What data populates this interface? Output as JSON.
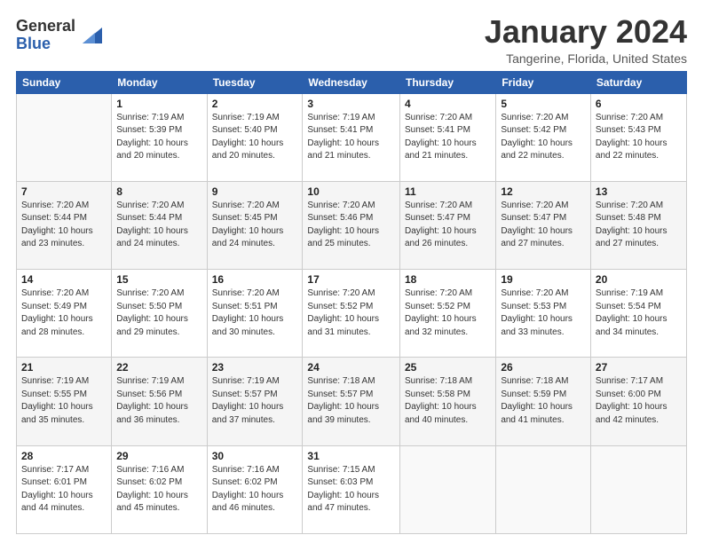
{
  "logo": {
    "general": "General",
    "blue": "Blue"
  },
  "title": "January 2024",
  "location": "Tangerine, Florida, United States",
  "headers": [
    "Sunday",
    "Monday",
    "Tuesday",
    "Wednesday",
    "Thursday",
    "Friday",
    "Saturday"
  ],
  "weeks": [
    [
      {
        "day": "",
        "info": ""
      },
      {
        "day": "1",
        "info": "Sunrise: 7:19 AM\nSunset: 5:39 PM\nDaylight: 10 hours\nand 20 minutes."
      },
      {
        "day": "2",
        "info": "Sunrise: 7:19 AM\nSunset: 5:40 PM\nDaylight: 10 hours\nand 20 minutes."
      },
      {
        "day": "3",
        "info": "Sunrise: 7:19 AM\nSunset: 5:41 PM\nDaylight: 10 hours\nand 21 minutes."
      },
      {
        "day": "4",
        "info": "Sunrise: 7:20 AM\nSunset: 5:41 PM\nDaylight: 10 hours\nand 21 minutes."
      },
      {
        "day": "5",
        "info": "Sunrise: 7:20 AM\nSunset: 5:42 PM\nDaylight: 10 hours\nand 22 minutes."
      },
      {
        "day": "6",
        "info": "Sunrise: 7:20 AM\nSunset: 5:43 PM\nDaylight: 10 hours\nand 22 minutes."
      }
    ],
    [
      {
        "day": "7",
        "info": "Sunrise: 7:20 AM\nSunset: 5:44 PM\nDaylight: 10 hours\nand 23 minutes."
      },
      {
        "day": "8",
        "info": "Sunrise: 7:20 AM\nSunset: 5:44 PM\nDaylight: 10 hours\nand 24 minutes."
      },
      {
        "day": "9",
        "info": "Sunrise: 7:20 AM\nSunset: 5:45 PM\nDaylight: 10 hours\nand 24 minutes."
      },
      {
        "day": "10",
        "info": "Sunrise: 7:20 AM\nSunset: 5:46 PM\nDaylight: 10 hours\nand 25 minutes."
      },
      {
        "day": "11",
        "info": "Sunrise: 7:20 AM\nSunset: 5:47 PM\nDaylight: 10 hours\nand 26 minutes."
      },
      {
        "day": "12",
        "info": "Sunrise: 7:20 AM\nSunset: 5:47 PM\nDaylight: 10 hours\nand 27 minutes."
      },
      {
        "day": "13",
        "info": "Sunrise: 7:20 AM\nSunset: 5:48 PM\nDaylight: 10 hours\nand 27 minutes."
      }
    ],
    [
      {
        "day": "14",
        "info": "Sunrise: 7:20 AM\nSunset: 5:49 PM\nDaylight: 10 hours\nand 28 minutes."
      },
      {
        "day": "15",
        "info": "Sunrise: 7:20 AM\nSunset: 5:50 PM\nDaylight: 10 hours\nand 29 minutes."
      },
      {
        "day": "16",
        "info": "Sunrise: 7:20 AM\nSunset: 5:51 PM\nDaylight: 10 hours\nand 30 minutes."
      },
      {
        "day": "17",
        "info": "Sunrise: 7:20 AM\nSunset: 5:52 PM\nDaylight: 10 hours\nand 31 minutes."
      },
      {
        "day": "18",
        "info": "Sunrise: 7:20 AM\nSunset: 5:52 PM\nDaylight: 10 hours\nand 32 minutes."
      },
      {
        "day": "19",
        "info": "Sunrise: 7:20 AM\nSunset: 5:53 PM\nDaylight: 10 hours\nand 33 minutes."
      },
      {
        "day": "20",
        "info": "Sunrise: 7:19 AM\nSunset: 5:54 PM\nDaylight: 10 hours\nand 34 minutes."
      }
    ],
    [
      {
        "day": "21",
        "info": "Sunrise: 7:19 AM\nSunset: 5:55 PM\nDaylight: 10 hours\nand 35 minutes."
      },
      {
        "day": "22",
        "info": "Sunrise: 7:19 AM\nSunset: 5:56 PM\nDaylight: 10 hours\nand 36 minutes."
      },
      {
        "day": "23",
        "info": "Sunrise: 7:19 AM\nSunset: 5:57 PM\nDaylight: 10 hours\nand 37 minutes."
      },
      {
        "day": "24",
        "info": "Sunrise: 7:18 AM\nSunset: 5:57 PM\nDaylight: 10 hours\nand 39 minutes."
      },
      {
        "day": "25",
        "info": "Sunrise: 7:18 AM\nSunset: 5:58 PM\nDaylight: 10 hours\nand 40 minutes."
      },
      {
        "day": "26",
        "info": "Sunrise: 7:18 AM\nSunset: 5:59 PM\nDaylight: 10 hours\nand 41 minutes."
      },
      {
        "day": "27",
        "info": "Sunrise: 7:17 AM\nSunset: 6:00 PM\nDaylight: 10 hours\nand 42 minutes."
      }
    ],
    [
      {
        "day": "28",
        "info": "Sunrise: 7:17 AM\nSunset: 6:01 PM\nDaylight: 10 hours\nand 44 minutes."
      },
      {
        "day": "29",
        "info": "Sunrise: 7:16 AM\nSunset: 6:02 PM\nDaylight: 10 hours\nand 45 minutes."
      },
      {
        "day": "30",
        "info": "Sunrise: 7:16 AM\nSunset: 6:02 PM\nDaylight: 10 hours\nand 46 minutes."
      },
      {
        "day": "31",
        "info": "Sunrise: 7:15 AM\nSunset: 6:03 PM\nDaylight: 10 hours\nand 47 minutes."
      },
      {
        "day": "",
        "info": ""
      },
      {
        "day": "",
        "info": ""
      },
      {
        "day": "",
        "info": ""
      }
    ]
  ]
}
